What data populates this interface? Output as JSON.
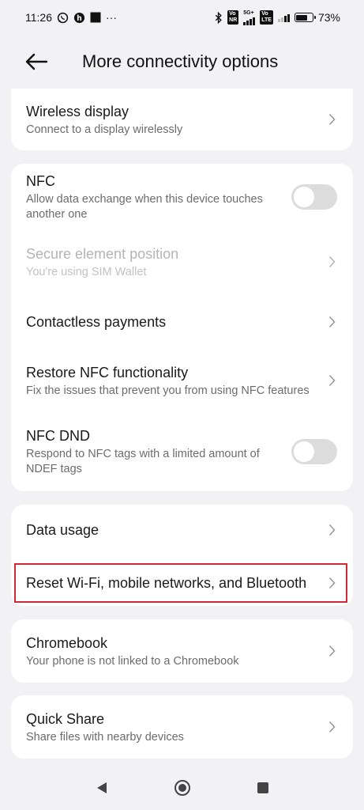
{
  "status_bar": {
    "time": "11:26",
    "more": "···",
    "volte_badge": "Vo\nNR",
    "network_badge": "5G+",
    "lte_badge": "Vo\nLTE",
    "battery_percent": "73%",
    "battery_level": 0.73
  },
  "header": {
    "title": "More connectivity options"
  },
  "cards": {
    "wireless": {
      "title": "Wireless display",
      "subtitle": "Connect to a display wirelessly"
    },
    "nfc": {
      "title": "NFC",
      "subtitle": "Allow data exchange when this device touches another one",
      "enabled": false
    },
    "secure_element": {
      "title": "Secure element position",
      "subtitle": "You're using SIM  Wallet"
    },
    "contactless": {
      "title": "Contactless payments"
    },
    "restore_nfc": {
      "title": "Restore NFC functionality",
      "subtitle": "Fix the issues that prevent you from using NFC features"
    },
    "nfc_dnd": {
      "title": "NFC DND",
      "subtitle": "Respond to NFC tags with a limited amount of NDEF tags",
      "enabled": false
    },
    "data_usage": {
      "title": "Data usage"
    },
    "reset": {
      "title": "Reset Wi-Fi, mobile networks, and Bluetooth"
    },
    "chromebook": {
      "title": "Chromebook",
      "subtitle": "Your phone is not linked to a Chromebook"
    },
    "quick_share": {
      "title": "Quick Share",
      "subtitle": "Share files with nearby devices"
    }
  },
  "colors": {
    "background": "#f2f2f4",
    "card": "#ffffff",
    "highlight": "#d12a36",
    "toggle_off": "#dcdcdc"
  }
}
